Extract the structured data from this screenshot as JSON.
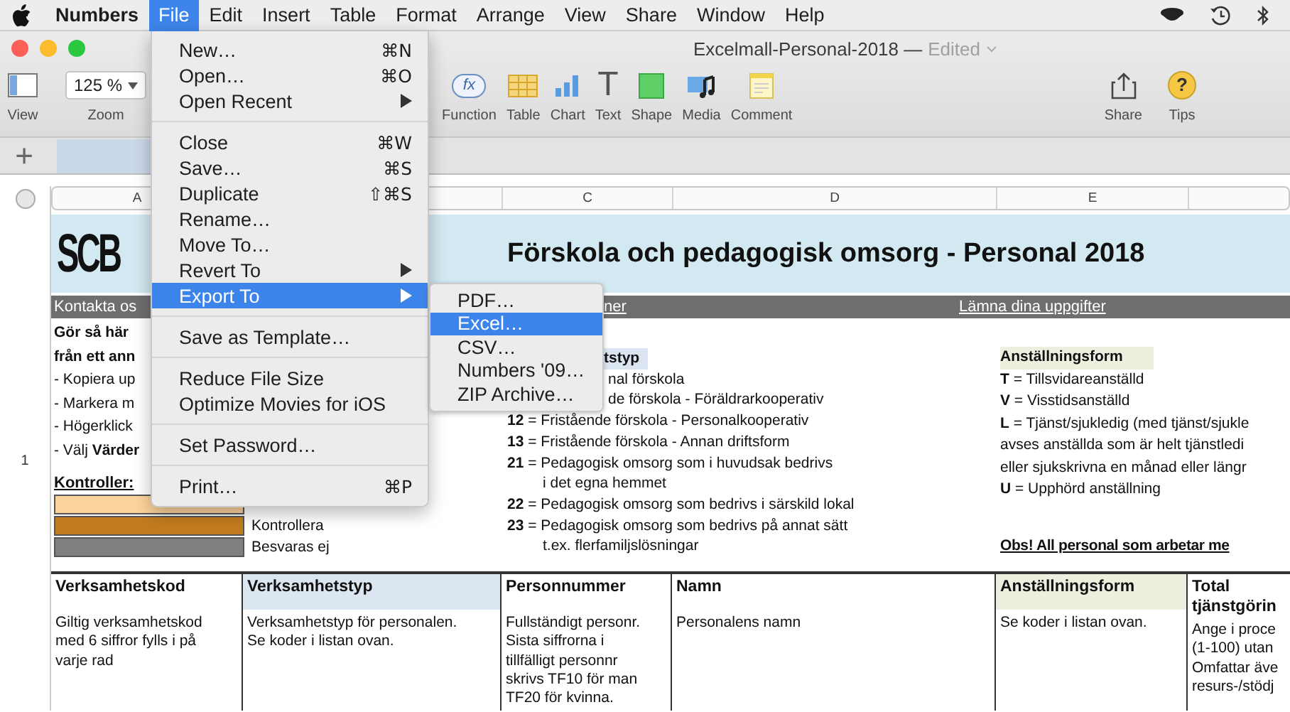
{
  "menubar": {
    "items": [
      {
        "label": "Numbers",
        "kind": "app",
        "selected": false
      },
      {
        "label": "File",
        "kind": "menu",
        "selected": true
      },
      {
        "label": "Edit",
        "kind": "menu",
        "selected": false
      },
      {
        "label": "Insert",
        "kind": "menu",
        "selected": false
      },
      {
        "label": "Table",
        "kind": "menu",
        "selected": false
      },
      {
        "label": "Format",
        "kind": "menu",
        "selected": false
      },
      {
        "label": "Arrange",
        "kind": "menu",
        "selected": false
      },
      {
        "label": "View",
        "kind": "menu",
        "selected": false
      },
      {
        "label": "Share",
        "kind": "menu",
        "selected": false
      },
      {
        "label": "Window",
        "kind": "menu",
        "selected": false
      },
      {
        "label": "Help",
        "kind": "menu",
        "selected": false
      }
    ]
  },
  "window": {
    "title": "Excelmall-Personal-2018 —",
    "status": "Edited"
  },
  "toolbar": {
    "left": [
      {
        "kind": "view",
        "label": "View"
      },
      {
        "kind": "zoom",
        "label": "Zoom",
        "value": "125 %"
      }
    ],
    "middle": [
      {
        "kind": "function",
        "label": "Function",
        "glyph": "fx"
      },
      {
        "kind": "table",
        "label": "Table"
      },
      {
        "kind": "chart",
        "label": "Chart"
      },
      {
        "kind": "text",
        "label": "Text",
        "glyph": "T"
      },
      {
        "kind": "shape",
        "label": "Shape"
      },
      {
        "kind": "media",
        "label": "Media"
      },
      {
        "kind": "comment",
        "label": "Comment"
      }
    ],
    "right": [
      {
        "kind": "share",
        "label": "Share"
      },
      {
        "kind": "tips",
        "label": "Tips",
        "glyph": "?"
      }
    ]
  },
  "sheet_tabs": {
    "add_button": "+"
  },
  "file_menu": {
    "groups": [
      [
        {
          "label": "New…",
          "shortcut": "⌘N",
          "submenu": false,
          "selected": false
        },
        {
          "label": "Open…",
          "shortcut": "⌘O",
          "submenu": false,
          "selected": false
        },
        {
          "label": "Open Recent",
          "submenu": true,
          "selected": false
        }
      ],
      [
        {
          "label": "Close",
          "shortcut": "⌘W",
          "submenu": false,
          "selected": false
        },
        {
          "label": "Save…",
          "shortcut": "⌘S",
          "submenu": false,
          "selected": false
        },
        {
          "label": "Duplicate",
          "shortcut": "⇧⌘S",
          "submenu": false,
          "selected": false
        },
        {
          "label": "Rename…",
          "submenu": false,
          "selected": false
        },
        {
          "label": "Move To…",
          "submenu": false,
          "selected": false
        },
        {
          "label": "Revert To",
          "submenu": true,
          "selected": false
        },
        {
          "label": "Export To",
          "submenu": true,
          "selected": true
        }
      ],
      [
        {
          "label": "Save as Template…",
          "submenu": false,
          "selected": false
        }
      ],
      [
        {
          "label": "Reduce File Size",
          "submenu": false,
          "selected": false
        },
        {
          "label": "Optimize Movies for iOS",
          "submenu": false,
          "selected": false
        }
      ],
      [
        {
          "label": "Set Password…",
          "submenu": false,
          "selected": false
        }
      ],
      [
        {
          "label": "Print…",
          "shortcut": "⌘P",
          "submenu": false,
          "selected": false
        }
      ]
    ]
  },
  "export_submenu": {
    "items": [
      {
        "label": "PDF…",
        "selected": false
      },
      {
        "label": "Excel…",
        "selected": true
      },
      {
        "label": "CSV…",
        "selected": false
      },
      {
        "label": "Numbers '09…",
        "selected": false
      },
      {
        "label": "ZIP Archive…",
        "selected": false
      }
    ]
  },
  "sheet": {
    "column_headers": [
      "A",
      "C",
      "D",
      "E"
    ],
    "row_number": "1",
    "logo": "SCB",
    "title": "Förskola och pedagogisk omsorg - Personal 2018",
    "info_bar": [
      {
        "text": "Kontakta os",
        "kind": "plain"
      },
      {
        "text": "ner",
        "kind": "link"
      },
      {
        "text": "Lämna dina uppgifter",
        "kind": "link"
      }
    ],
    "instructions": [
      {
        "text": "Gör så här",
        "kind": "heading"
      },
      {
        "text": "från ett ann",
        "kind": "heading"
      },
      {
        "text": "- Kopiera up",
        "kind": "step"
      },
      {
        "text": "- Markera m",
        "kind": "step"
      },
      {
        "text": "- Högerklick",
        "kind": "step"
      },
      {
        "text": "- Välj **Värder**",
        "kind": "step"
      }
    ],
    "controls": {
      "label": "Kontroller:",
      "swatches": [
        {
          "color": "#fcd39c"
        },
        {
          "color": "#c27c1e",
          "label": "Kontrollera"
        },
        {
          "color": "#7f7f7f",
          "label": "Besvaras ej"
        }
      ]
    },
    "types": {
      "heading": "tstyp",
      "lines": [
        {
          "text": "nal förskola",
          "kind": "partial"
        },
        {
          "text": "de förskola - Föräldrarkooperativ",
          "kind": "partial"
        },
        {
          "text": "**12** = Fristående förskola - Personalkooperativ",
          "kind": "code"
        },
        {
          "text": "**13** = Fristående förskola - Annan driftsform",
          "kind": "code"
        },
        {
          "text": "**21** = Pedagogisk omsorg som i huvudsak bedrivs",
          "kind": "code"
        },
        {
          "text": "i det egna hemmet",
          "kind": "continued"
        },
        {
          "text": "**22** = Pedagogisk omsorg som bedrivs i särskild lokal",
          "kind": "code"
        },
        {
          "text": "**23** = Pedagogisk omsorg som bedrivs på annat sätt",
          "kind": "code"
        },
        {
          "text": "t.ex. flerfamiljslösningar",
          "kind": "continued"
        }
      ]
    },
    "employment": {
      "heading": "Anställningsform",
      "lines": [
        "**T** = Tillsvidareanställd",
        "**V** = Visstidsanställd",
        "**L** = Tjänst/sjukledig (med tjänst/sjukle",
        "avses anställda som är helt tjänstledi",
        "eller sjukskrivna en månad eller längr",
        "**U** = Upphörd anställning"
      ],
      "note": "Obs! All personal som arbetar me"
    },
    "table": {
      "columns": [
        {
          "name": "Verksamhetskod",
          "color": "#ffffff",
          "hint": "Giltig verksamhetskod\nmed 6 siffror fylls i på\nvarje rad"
        },
        {
          "name": "Verksamhetstyp",
          "color": "#dce6f1",
          "hint": "Verksamhetstyp för personalen.\nSe koder i listan ovan."
        },
        {
          "name": "Personnummer",
          "color": "#ffffff",
          "hint": "Fullständigt personr.\nSista siffrorna i\ntillfälligt personnr\nskrivs TF10 för man\nTF20 för kvinna."
        },
        {
          "name": "Namn",
          "color": "#ffffff",
          "hint": "Personalens namn"
        },
        {
          "name": "Anställningsform",
          "color": "#ebf1de",
          "hint": "Se koder i listan ovan."
        },
        {
          "name": "Total\ntjänstgörin",
          "color": "#ffffff",
          "hint": "Ange i proce\n(1-100) utan\nOmfattar äve\nresurs-/stödj"
        }
      ]
    }
  }
}
